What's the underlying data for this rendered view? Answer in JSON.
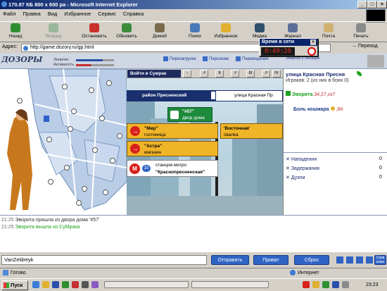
{
  "window": {
    "title": "170.87 КБ 800 x 600 ра - Microsoft Internet Explorer"
  },
  "menu": [
    "Файл",
    "Правка",
    "Вид",
    "Избранное",
    "Сервис",
    "Справка"
  ],
  "toolbar": {
    "back": "Назад",
    "forward": "Вперед",
    "stop": "Остановить",
    "refresh": "Обновить",
    "home": "Домой",
    "search": "Поиск",
    "favorites": "Избранное",
    "media": "Медиа",
    "history": "Журнал",
    "mail": "Почта",
    "print": "Печать"
  },
  "address": {
    "label": "Адрес:",
    "url": "http://game.dozory.ru/gp.html",
    "go": "Переход"
  },
  "timer": {
    "title": "Время в сети",
    "value": "0:49:28"
  },
  "game": {
    "logo": "ДОЗОРЫ",
    "energy_label": "Энергия",
    "activity_label": "Активность",
    "nav": [
      "Перезагрузка",
      "Персонаж",
      "Перевидение",
      "Энергия у локации"
    ]
  },
  "scene": {
    "enter_label": "Войти в Сумрак",
    "nav_buttons": [
      "I",
      "II",
      "III",
      "IV"
    ],
    "district": "район Пресненский",
    "street": "улица Красная Пр",
    "house_number": "\"#57\"",
    "house_type": "двор дома",
    "mir_name": "\"Мир\"",
    "mir_type": "гостиница",
    "vostochnaya_name": "'Восточная'",
    "vostochnaya_type": "свалка",
    "astra_name": "\"Астра\"",
    "astra_type": "магазин",
    "metro_prefix": "станция метро",
    "metro_name": "\"Краснопресненская\"",
    "metro_badge": "10"
  },
  "right": {
    "location": "улица Красная Пресня",
    "players": "Игроков: 2 (из них в боях 0)",
    "player1_name": "Эворита",
    "player1_stats": ",34,27,ск7",
    "player2_name": "Боль кошмара",
    "player2_stats": ",84",
    "attacks_label": "Нападения",
    "attacks_value": "0",
    "arrests_label": "Задержания",
    "arrests_value": "0",
    "duels_label": "Дуэли",
    "duels_value": "0"
  },
  "chat": [
    {
      "time": "21:25",
      "text": "Эворита пришла из двора дома '#57'"
    },
    {
      "time": "21:25",
      "text": "Эворита вышла из СуМрака"
    }
  ],
  "input": {
    "value": "VanZeldreyk"
  },
  "buttons": {
    "send": "Отправить",
    "private": "Приват",
    "reset": "Сброс",
    "service": "Серв кома"
  },
  "status": {
    "left": "Готово",
    "zone": "Интернет"
  },
  "taskbar": {
    "start": "Пуск",
    "clock": "23:23"
  },
  "colors": {
    "accent": "#2f64c4",
    "green": "#19a019",
    "red": "#d8201a",
    "sign_orange": "#f0b428"
  }
}
